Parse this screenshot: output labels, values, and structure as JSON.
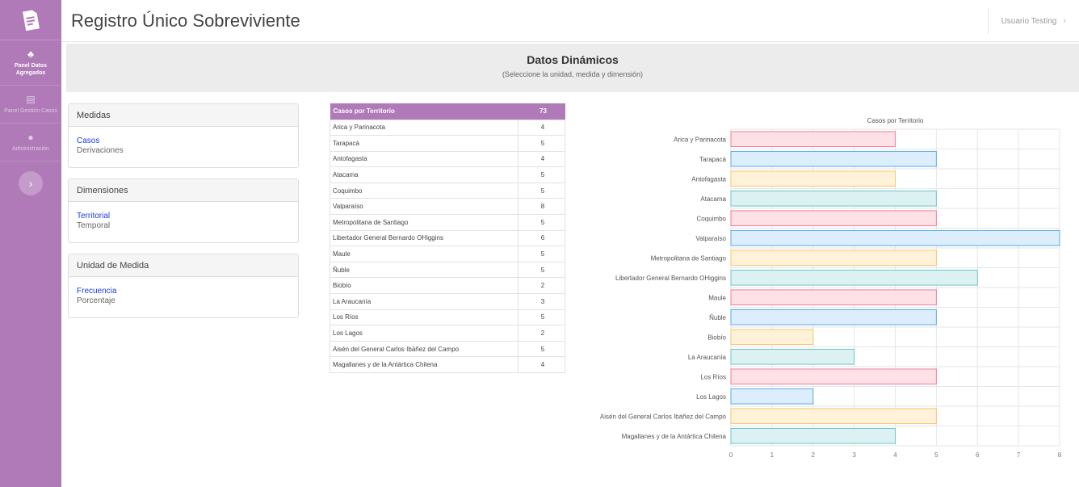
{
  "sidebar": {
    "items": [
      {
        "label": "Panel Datos Agregados",
        "icon": "chart-icon",
        "active": true
      },
      {
        "label": "Panel Gestión Casos",
        "icon": "list-icon",
        "active": false
      },
      {
        "label": "Administración",
        "icon": "user-icon",
        "active": false
      }
    ]
  },
  "header": {
    "title": "Registro Único Sobreviviente",
    "user": "Usuario Testing"
  },
  "banner": {
    "title": "Datos Dinámicos",
    "subtitle": "(Seleccione la unidad, medida y dimensión)"
  },
  "panels": {
    "medidas": {
      "title": "Medidas",
      "options": [
        "Casos",
        "Derivaciones"
      ]
    },
    "dimensiones": {
      "title": "Dimensiones",
      "options": [
        "Territorial",
        "Temporal"
      ]
    },
    "unidad": {
      "title": "Unidad de Medida",
      "options": [
        "Frecuencia",
        "Porcentaje"
      ]
    }
  },
  "table": {
    "header_label": "Casos por Territorio",
    "header_total": "73",
    "rows": [
      {
        "name": "Arica y Parinacota",
        "value": "4"
      },
      {
        "name": "Tarapacá",
        "value": "5"
      },
      {
        "name": "Antofagasta",
        "value": "4"
      },
      {
        "name": "Atacama",
        "value": "5"
      },
      {
        "name": "Coquimbo",
        "value": "5"
      },
      {
        "name": "Valparaíso",
        "value": "8"
      },
      {
        "name": "Metropolitana de Santiago",
        "value": "5"
      },
      {
        "name": "Libertador General Bernardo OHiggins",
        "value": "6"
      },
      {
        "name": "Maule",
        "value": "5"
      },
      {
        "name": "Ñuble",
        "value": "5"
      },
      {
        "name": "Biobío",
        "value": "2"
      },
      {
        "name": "La Araucanía",
        "value": "3"
      },
      {
        "name": "Los Ríos",
        "value": "5"
      },
      {
        "name": "Los Lagos",
        "value": "2"
      },
      {
        "name": "Aisén del General Carlos Ibáñez del Campo",
        "value": "5"
      },
      {
        "name": "Magallanes y de la Antártica Chilena",
        "value": "4"
      }
    ]
  },
  "chart_data": {
    "type": "bar",
    "orientation": "horizontal",
    "title": "Casos por Territorio",
    "categories": [
      "Arica y Parinacota",
      "Tarapacá",
      "Antofagasta",
      "Atacama",
      "Coquimbo",
      "Valparaíso",
      "Metropolitana de Santiago",
      "Libertador General Bernardo OHiggins",
      "Maule",
      "Ñuble",
      "Biobío",
      "La Araucanía",
      "Los Ríos",
      "Los Lagos",
      "Aisén del General Carlos Ibáñez del Campo",
      "Magallanes y de la Antártica Chilena"
    ],
    "values": [
      4,
      5,
      4,
      5,
      5,
      8,
      5,
      6,
      5,
      5,
      2,
      3,
      5,
      2,
      5,
      4
    ],
    "xlim": [
      0,
      8
    ],
    "xticks": [
      0,
      1,
      2,
      3,
      4,
      5,
      6,
      7,
      8
    ],
    "grid": true,
    "colors": [
      {
        "fill": "#fde1e7",
        "stroke": "#f27d95"
      },
      {
        "fill": "#dcedfb",
        "stroke": "#5aaae6"
      },
      {
        "fill": "#fff2d9",
        "stroke": "#f7c66b"
      },
      {
        "fill": "#dcf2f2",
        "stroke": "#6cc6c6"
      }
    ]
  }
}
